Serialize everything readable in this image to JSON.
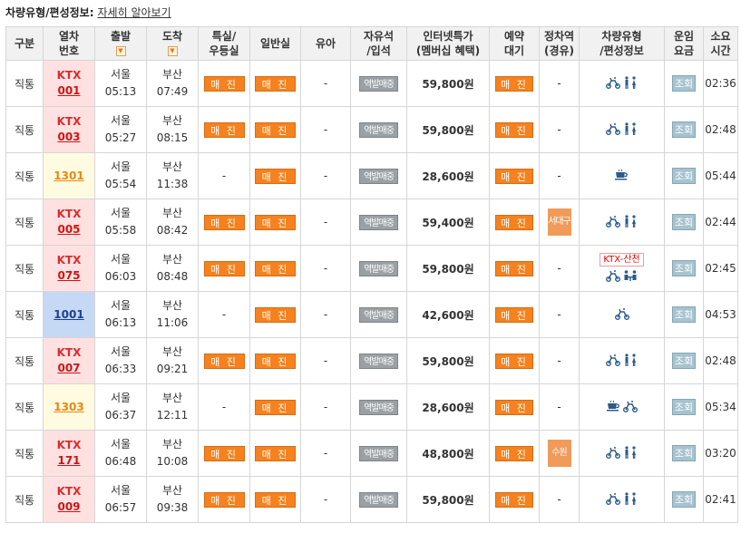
{
  "header": {
    "label": "차량유형/편성정보:",
    "link": "자세히 알아보기"
  },
  "columns": {
    "type": "구분",
    "train_l1": "열차",
    "train_l2": "번호",
    "dep": "출발",
    "arr": "도착",
    "special_l1": "특실/",
    "special_l2": "우등실",
    "general": "일반실",
    "child": "유아",
    "free_l1": "자유석",
    "free_l2": "/입석",
    "internet_l1": "인터넷특가",
    "internet_l2": "(멤버십 혜택)",
    "reserve_l1": "예약",
    "reserve_l2": "대기",
    "stop_l1": "정차역",
    "stop_l2": "(경유)",
    "vehicle_l1": "차량유형",
    "vehicle_l2": "/편성정보",
    "fare_l1": "운임",
    "fare_l2": "요금",
    "duration_l1": "소요",
    "duration_l2": "시간"
  },
  "labels": {
    "sold_out": "매 진",
    "station_sale": "역발매중",
    "view": "조회",
    "dash": "-"
  },
  "rows": [
    {
      "type": "직통",
      "class": "ktx",
      "kname": "KTX",
      "number": "001",
      "dep_station": "서울",
      "dep_time": "05:13",
      "arr_station": "부산",
      "arr_time": "07:49",
      "special": "sold",
      "general": "sold",
      "child": "-",
      "free": "station",
      "price": "59,800원",
      "reserve": "sold",
      "stop": "-",
      "vehicle": [
        "wheelchair-bike",
        "restroom"
      ],
      "duration": "02:36"
    },
    {
      "type": "직통",
      "class": "ktx",
      "kname": "KTX",
      "number": "003",
      "dep_station": "서울",
      "dep_time": "05:27",
      "arr_station": "부산",
      "arr_time": "08:15",
      "special": "sold",
      "general": "sold",
      "child": "-",
      "free": "station",
      "price": "59,800원",
      "reserve": "sold",
      "stop": "-",
      "vehicle": [
        "wheelchair-bike",
        "restroom"
      ],
      "duration": "02:48"
    },
    {
      "type": "직통",
      "class": "mugung",
      "kname": "",
      "number": "1301",
      "dep_station": "서울",
      "dep_time": "05:54",
      "arr_station": "부산",
      "arr_time": "11:38",
      "special": "-",
      "general": "sold",
      "child": "-",
      "free": "station",
      "price": "28,600원",
      "reserve": "sold",
      "stop": "-",
      "vehicle": [
        "cafe"
      ],
      "duration": "05:44"
    },
    {
      "type": "직통",
      "class": "ktx",
      "kname": "KTX",
      "number": "005",
      "dep_station": "서울",
      "dep_time": "05:58",
      "arr_station": "부산",
      "arr_time": "08:42",
      "special": "sold",
      "general": "sold",
      "child": "-",
      "free": "station",
      "price": "59,400원",
      "reserve": "sold",
      "stop": "서대구",
      "vehicle": [
        "wheelchair-bike",
        "restroom"
      ],
      "duration": "02:44"
    },
    {
      "type": "직통",
      "class": "ktx",
      "kname": "KTX",
      "number": "075",
      "dep_station": "서울",
      "dep_time": "06:03",
      "arr_station": "부산",
      "arr_time": "08:48",
      "special": "sold",
      "general": "sold",
      "child": "-",
      "free": "station",
      "price": "59,800원",
      "reserve": "sold",
      "stop": "-",
      "tag": "KTX-산천",
      "vehicle": [
        "wheelchair-bike",
        "meeting"
      ],
      "duration": "02:45"
    },
    {
      "type": "직통",
      "class": "nuriro",
      "kname": "",
      "number": "1001",
      "dep_station": "서울",
      "dep_time": "06:13",
      "arr_station": "부산",
      "arr_time": "11:06",
      "special": "-",
      "general": "sold",
      "child": "-",
      "free": "station",
      "price": "42,600원",
      "reserve": "sold",
      "stop": "-",
      "vehicle": [
        "wheelchair-bike"
      ],
      "duration": "04:53"
    },
    {
      "type": "직통",
      "class": "ktx",
      "kname": "KTX",
      "number": "007",
      "dep_station": "서울",
      "dep_time": "06:33",
      "arr_station": "부산",
      "arr_time": "09:21",
      "special": "sold",
      "general": "sold",
      "child": "-",
      "free": "station",
      "price": "59,800원",
      "reserve": "sold",
      "stop": "-",
      "vehicle": [
        "wheelchair-bike",
        "restroom"
      ],
      "duration": "02:48"
    },
    {
      "type": "직통",
      "class": "mugung",
      "kname": "",
      "number": "1303",
      "dep_station": "서울",
      "dep_time": "06:37",
      "arr_station": "부산",
      "arr_time": "12:11",
      "special": "-",
      "general": "sold",
      "child": "-",
      "free": "station",
      "price": "28,600원",
      "reserve": "sold",
      "stop": "-",
      "vehicle": [
        "cafe",
        "wheelchair-bike"
      ],
      "duration": "05:34"
    },
    {
      "type": "직통",
      "class": "ktx",
      "kname": "KTX",
      "number": "171",
      "dep_station": "서울",
      "dep_time": "06:48",
      "arr_station": "부산",
      "arr_time": "10:08",
      "special": "sold",
      "general": "sold",
      "child": "-",
      "free": "station",
      "price": "48,800원",
      "reserve": "sold",
      "stop": "수원",
      "vehicle": [
        "wheelchair-bike",
        "restroom"
      ],
      "duration": "03:20"
    },
    {
      "type": "직통",
      "class": "ktx",
      "kname": "KTX",
      "number": "009",
      "dep_station": "서울",
      "dep_time": "06:57",
      "arr_station": "부산",
      "arr_time": "09:38",
      "special": "sold",
      "general": "sold",
      "child": "-",
      "free": "station",
      "price": "59,800원",
      "reserve": "sold",
      "stop": "-",
      "vehicle": [
        "wheelchair-bike",
        "restroom"
      ],
      "duration": "02:41"
    }
  ]
}
